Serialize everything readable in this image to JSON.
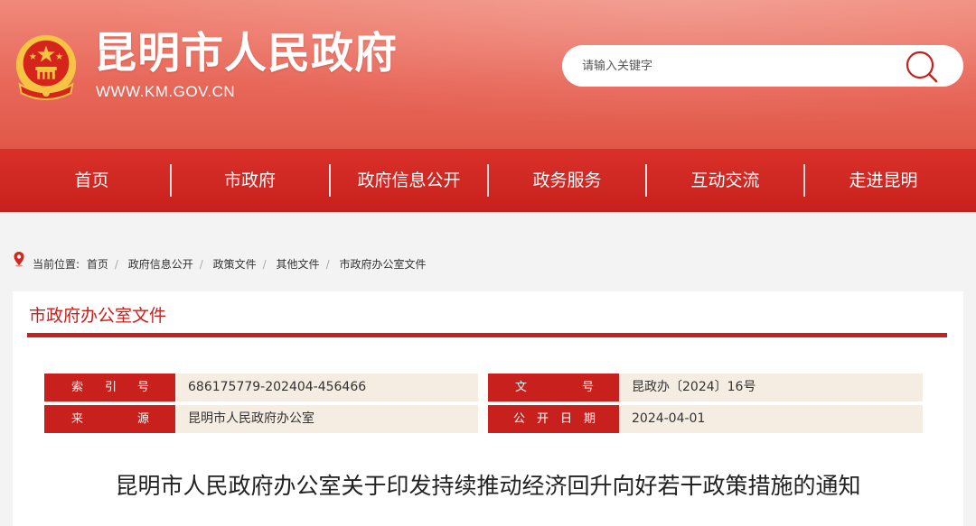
{
  "header": {
    "site_title": "昆明市人民政府",
    "site_url": "WWW.KM.GOV.CN",
    "emblem_icon": "national-emblem-icon",
    "search": {
      "placeholder": "请输入关键字",
      "value": "",
      "icon": "search-icon"
    }
  },
  "nav": {
    "items": [
      {
        "label": "首页"
      },
      {
        "label": "市政府"
      },
      {
        "label": "政府信息公开"
      },
      {
        "label": "政务服务"
      },
      {
        "label": "互动交流"
      },
      {
        "label": "走进昆明"
      }
    ]
  },
  "breadcrumb": {
    "icon": "location-pin-icon",
    "prefix": "当前位置:",
    "items": [
      "首页",
      "政府信息公开",
      "政策文件",
      "其他文件",
      "市政府办公室文件"
    ]
  },
  "section": {
    "title": "市政府办公室文件"
  },
  "meta": {
    "index_label_chars": [
      "索",
      "引",
      "号"
    ],
    "index_value": "686175779-202404-456466",
    "doc_no_label_chars": [
      "文",
      "号"
    ],
    "doc_no_value": "昆政办〔2024〕16号",
    "source_label_chars": [
      "来",
      "源"
    ],
    "source_value": "昆明市人民政府办公室",
    "date_label_chars": [
      "公",
      "开",
      "日",
      "期"
    ],
    "date_value": "2024-04-01"
  },
  "document": {
    "title": "昆明市人民政府办公室关于印发持续推动经济回升向好若干政策措施的通知"
  },
  "colors": {
    "brand_red": "#c8201c",
    "header_top": "#f0897a",
    "meta_bg": "#f5ede2"
  }
}
